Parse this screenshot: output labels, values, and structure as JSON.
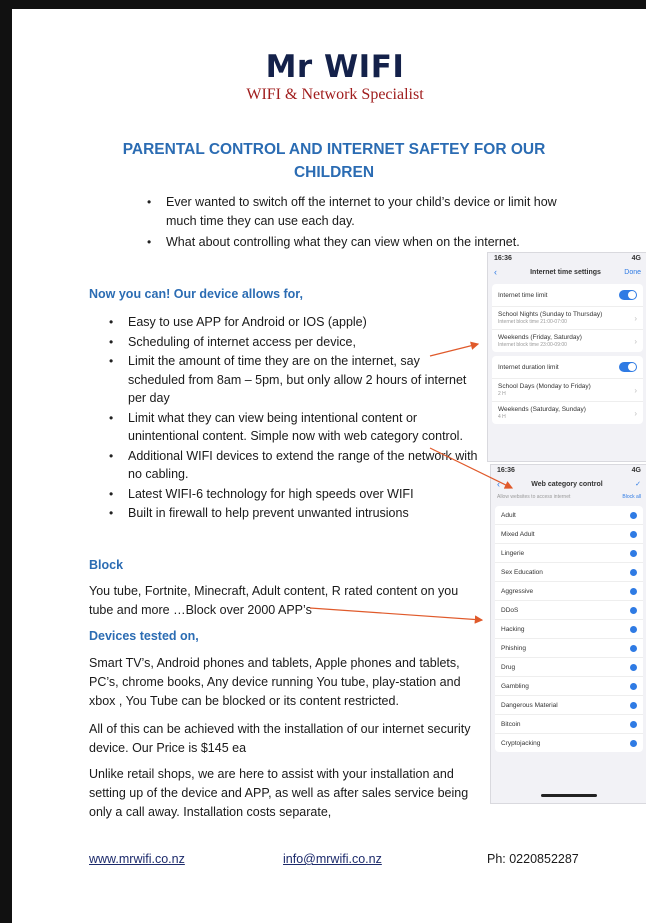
{
  "brand": {
    "name": "Mr WIFI",
    "tagline": "WIFI & Network Specialist"
  },
  "headline": "PARENTAL CONTROL AND INTERNET SAFTEY FOR OUR CHILDREN",
  "intro_bullets": [
    "Ever wanted to switch off the internet to your child’s device or limit how much time they can use each day.",
    "What about controlling what they can view when on the internet."
  ],
  "features_heading": "Now you can! Our device allows for,",
  "features": [
    "Easy to use APP for Android or IOS (apple)",
    "Scheduling of internet access per device,",
    "Limit the amount of time they are on the internet, say scheduled from 8am – 5pm, but only allow 2 hours of internet per day",
    "Limit what they can view being intentional content or unintentional content. Simple now with web category control.",
    "Additional WIFI devices to extend the range of the network with no cabling.",
    "Latest WIFI-6 technology for high speeds over WIFI",
    "Built in firewall to help prevent unwanted intrusions"
  ],
  "block": {
    "heading": "Block",
    "text": "You tube, Fortnite, Minecraft, Adult content, R rated content on you tube and more …Block over 2000 APP’s"
  },
  "devices": {
    "heading": "Devices tested on,",
    "text": "Smart TV’s, Android phones and tablets, Apple phones and tablets, PC’s, chrome books, Any device running You tube, play-station and xbox , You Tube can be blocked or its content restricted."
  },
  "price_text": "All of this can be achieved with the installation of our internet security device. Our Price is $145 ea",
  "service_text": "Unlike retail shops, we are here to assist with your installation and setting up of the device and APP, as well as after sales service being only a call away.   Installation costs separate,",
  "footer": {
    "website": "www.mrwifi.co.nz",
    "email": "info@mrwifi.co.nz",
    "phone": "Ph: 0220852287"
  },
  "phone1": {
    "time": "16:36",
    "status": "4G",
    "title": "Internet time settings",
    "action": "Done",
    "rows_a": [
      {
        "label": "Internet time limit"
      },
      {
        "label": "School Nights (Sunday to Thursday)",
        "detail": "Internet block time 21:00-07:00"
      },
      {
        "label": "Weekends (Friday, Saturday)",
        "detail": "Internet block time 23:00-09:00"
      }
    ],
    "rows_b": [
      {
        "label": "Internet duration limit"
      },
      {
        "label": "School Days (Monday to Friday)",
        "detail": "2 H"
      },
      {
        "label": "Weekends (Saturday, Sunday)",
        "detail": "4 H"
      }
    ]
  },
  "phone2": {
    "time": "16:36",
    "status": "4G",
    "title": "Web category control",
    "hint": "Allow websites to access internet",
    "hint_action": "Block all",
    "categories": [
      "Adult",
      "Mixed Adult",
      "Lingerie",
      "Sex Education",
      "Aggressive",
      "DDoS",
      "Hacking",
      "Phishing",
      "Drug",
      "Gambling",
      "Dangerous Material",
      "Bitcoin",
      "Cryptojacking"
    ]
  },
  "colors": {
    "navy": "#14214a",
    "red": "#a01d1d",
    "blue": "#2b6cb3",
    "arrow": "#e05a2b",
    "ios_blue": "#2f7be4"
  }
}
